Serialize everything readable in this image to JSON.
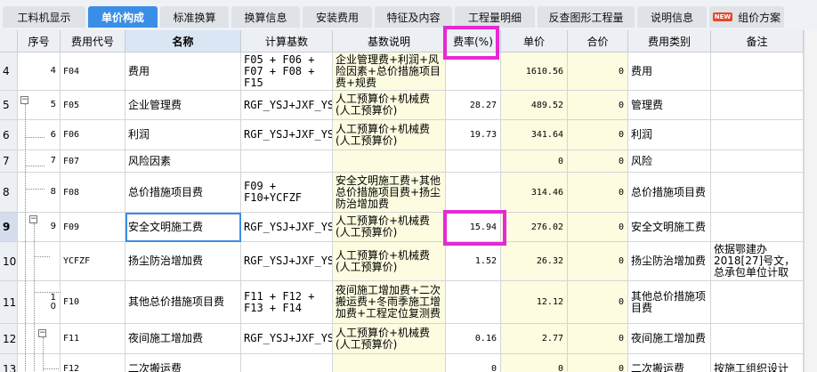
{
  "tabs": [
    {
      "label": "工料机显示",
      "active": false
    },
    {
      "label": "单价构成",
      "active": true
    },
    {
      "label": "标准换算",
      "active": false
    },
    {
      "label": "换算信息",
      "active": false
    },
    {
      "label": "安装费用",
      "active": false
    },
    {
      "label": "特征及内容",
      "active": false
    },
    {
      "label": "工程量明细",
      "active": false
    },
    {
      "label": "反查图形工程量",
      "active": false
    },
    {
      "label": "说明信息",
      "active": false
    },
    {
      "label": "组价方案",
      "active": false,
      "badge": "NEW"
    }
  ],
  "columns": [
    "序号",
    "费用代号",
    "名称",
    "计算基数",
    "基数说明",
    "费率(%)",
    "单价",
    "合价",
    "费用类别",
    "备注"
  ],
  "rows": [
    {
      "num": "4",
      "seq": "4",
      "code": "F04",
      "name": "费用",
      "base": "F05 + F06 + F07 + F08 + F15",
      "base_desc": "企业管理费+利润+风险因素+总价措施项目费+规费",
      "rate": "",
      "price": "1610.56",
      "total": "0",
      "category": "费用",
      "note": ""
    },
    {
      "num": "5",
      "seq": "5",
      "code": "F05",
      "name": "企业管理费",
      "base": "RGF_YSJ+JXF_YSJ",
      "base_desc": "人工预算价+机械费(人工预算价)",
      "rate": "28.27",
      "price": "489.52",
      "total": "0",
      "category": "管理费",
      "note": ""
    },
    {
      "num": "6",
      "seq": "6",
      "code": "F06",
      "name": "利润",
      "base": "RGF_YSJ+JXF_YSJ",
      "base_desc": "人工预算价+机械费(人工预算价)",
      "rate": "19.73",
      "price": "341.64",
      "total": "0",
      "category": "利润",
      "note": ""
    },
    {
      "num": "7",
      "seq": "7",
      "code": "F07",
      "name": "风险因素",
      "base": "",
      "base_desc": "",
      "rate": "",
      "price": "0",
      "total": "0",
      "category": "风险",
      "note": ""
    },
    {
      "num": "8",
      "seq": "8",
      "code": "F08",
      "name": "总价措施项目费",
      "base": "F09 + F10+YCFZF",
      "base_desc": "安全文明施工费+其他总价措施项目费+扬尘防治增加费",
      "rate": "",
      "price": "314.46",
      "total": "0",
      "category": "总价措施项目费",
      "note": ""
    },
    {
      "num": "9",
      "seq": "9",
      "code": "F09",
      "name": "安全文明施工费",
      "base": "RGF_YSJ+JXF_YSJ",
      "base_desc": "人工预算价+机械费(人工预算价)",
      "rate": "15.94",
      "price": "276.02",
      "total": "0",
      "category": "安全文明施工费",
      "note": ""
    },
    {
      "num": "10",
      "seq": "",
      "code": "YCFZF",
      "name": "扬尘防治增加费",
      "base": "RGF_YSJ+JXF_YSJ",
      "base_desc": "人工预算价+机械费(人工预算价)",
      "rate": "1.52",
      "price": "26.32",
      "total": "0",
      "category": "扬尘防治增加费",
      "note": "依据鄂建办2018[27]号文，总承包单位计取"
    },
    {
      "num": "11",
      "seq": "1\n0",
      "code": "F10",
      "name": "其他总价措施项目费",
      "base": "F11 + F12 + F13 + F14",
      "base_desc": "夜间施工增加费+二次搬运费+冬雨季施工增加费+工程定位复测费",
      "rate": "",
      "price": "12.12",
      "total": "0",
      "category": "其他总价措施项目费",
      "note": ""
    },
    {
      "num": "12",
      "seq": "",
      "code": "F11",
      "name": "夜间施工增加费",
      "base": "RGF_YSJ+JXF_YSJ",
      "base_desc": "人工预算价+机械费(人工预算价)",
      "rate": "0.16",
      "price": "2.77",
      "total": "0",
      "category": "夜间施工增加费",
      "note": ""
    },
    {
      "num": "13",
      "seq": "",
      "code": "F12",
      "name": "二次搬运费",
      "base": "",
      "base_desc": "",
      "rate": "0",
      "price": "0",
      "total": "0",
      "category": "二次搬运费",
      "note": "按施工组织设计"
    }
  ],
  "colors": {
    "accent": "#3a8ee6",
    "highlight": "#e629d3",
    "yellow": "#fdfbe0"
  },
  "icons": {
    "collapse": "minus-box-icon"
  }
}
